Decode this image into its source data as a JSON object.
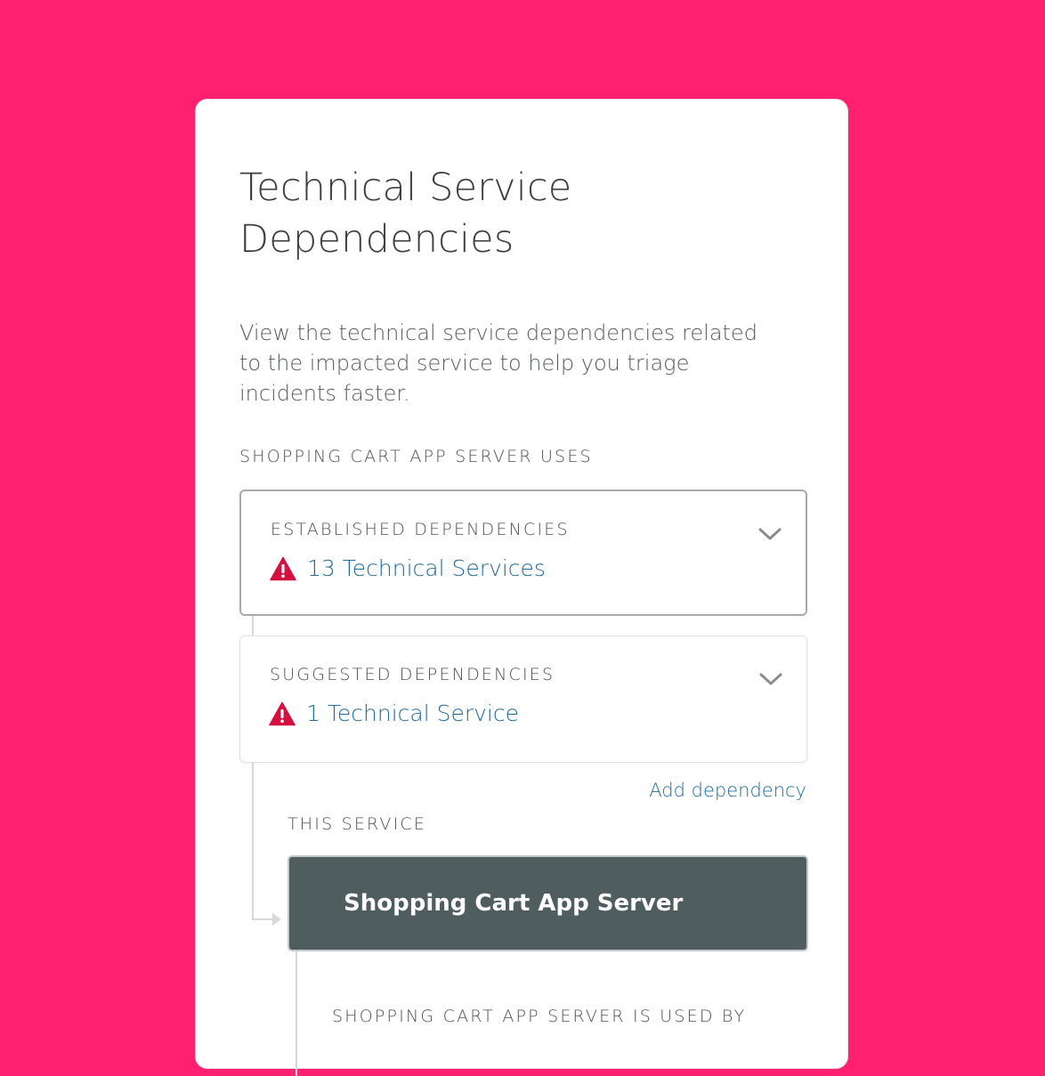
{
  "card": {
    "title_line1": "Technical Service",
    "title_line2": "Dependencies",
    "description": "View the technical service dependencies related to the impacted service to help you triage incidents faster.",
    "uses_label": "SHOPPING CART APP SERVER USES",
    "established": {
      "label": "ESTABLISHED DEPENDENCIES",
      "count_text": "13 Technical Services"
    },
    "suggested": {
      "label": "SUGGESTED DEPENDENCIES",
      "count_text": "1 Technical Service"
    },
    "add_dependency": "Add dependency",
    "this_service_label": "THIS SERVICE",
    "service_name": "Shopping Cart App Server",
    "used_by_label": "SHOPPING CART APP SERVER IS USED BY"
  },
  "colors": {
    "background": "#ff2170",
    "link": "#1f6b9c",
    "warning": "#d5103f",
    "service_box": "#4f5d5e"
  },
  "icons": {
    "warning": "warning-triangle-icon",
    "chevron": "chevron-down-icon"
  }
}
